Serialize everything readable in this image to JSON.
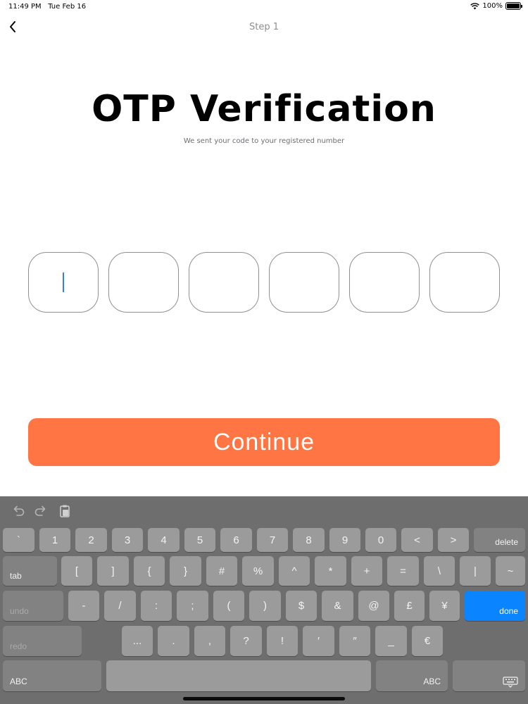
{
  "status_bar": {
    "time": "11:49 PM",
    "date": "Tue Feb 16",
    "battery": "100%"
  },
  "header": {
    "step_label": "Step 1"
  },
  "main": {
    "title": "OTP Verification",
    "subtitle": "We sent your code to your registered number",
    "otp_boxes": [
      "",
      "",
      "",
      "",
      "",
      ""
    ],
    "continue_label": "Continue"
  },
  "colors": {
    "accent": "#ff7543",
    "keyboard_bg": "#6e6e6e",
    "done_key": "#0a84ff",
    "cursor": "#2f80ed"
  },
  "keyboard": {
    "toolbar_icons": [
      "undo-icon",
      "redo-icon",
      "paste-icon"
    ],
    "row1": [
      "`",
      "1",
      "2",
      "3",
      "4",
      "5",
      "6",
      "7",
      "8",
      "9",
      "0",
      "<",
      ">"
    ],
    "delete": "delete",
    "tab": "tab",
    "row2": [
      "[",
      "]",
      "{",
      "}",
      "#",
      "%",
      "^",
      "*",
      "+",
      "=",
      "\\",
      "|",
      "~"
    ],
    "undo": "undo",
    "row3": [
      "-",
      "/",
      ":",
      ";",
      "(",
      ")",
      "$",
      "&",
      "@",
      "£",
      "¥"
    ],
    "done": "done",
    "redo": "redo",
    "row4": [
      "...",
      ".",
      ",",
      "?",
      "!",
      "′",
      "″",
      "_",
      "€"
    ],
    "abc_left": "ABC",
    "abc_right": "ABC",
    "dismiss_icon": "keyboard-dismiss-icon"
  }
}
